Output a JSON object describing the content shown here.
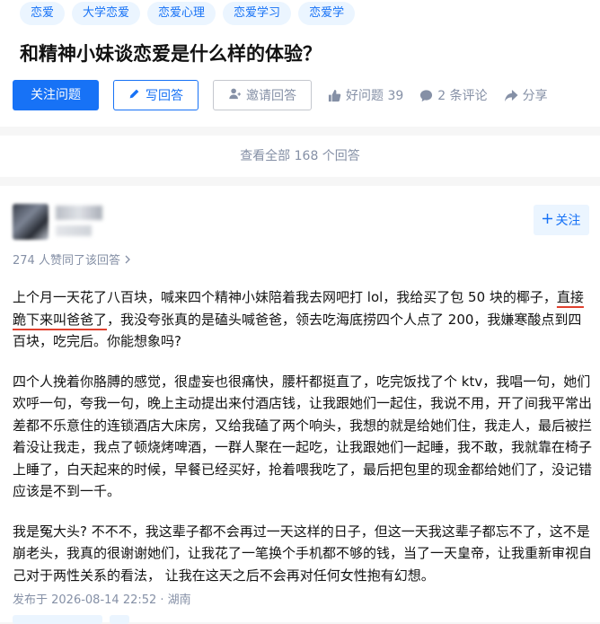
{
  "topics": [
    "恋爱",
    "大学恋爱",
    "恋爱心理",
    "恋爱学习",
    "恋爱学"
  ],
  "question": {
    "title": "和精神小妹谈恋爱是什么样的体验？"
  },
  "actions": {
    "follow_question": "关注问题",
    "write_answer": "写回答",
    "invite_answer": "邀请回答",
    "good_question": "好问题 39",
    "comments": "2 条评论",
    "share": "分享"
  },
  "view_all": "查看全部 168 个回答",
  "answer": {
    "follow_label": "关注",
    "voters": "274 人赞同了该回答",
    "p1_a": "上个月一天花了八百块，喊来四个精神小妹陪着我去网吧打 lol，我给买了包 50 块的椰子，",
    "p1_underlined": "直接跪下来叫爸爸了",
    "p1_b": "，我没夸张真的是磕头喊爸爸，领去吃海底捞四个人点了 200，我嫌寒酸点到四百块，吃完后。你能想象吗?",
    "p2": "四个人挽着你胳膊的感觉，很虚妄也很痛快，腰杆都挺直了，吃完饭找了个 ktv，我唱一句，她们欢呼一句，夸我一句，晚上主动提出来付酒店钱，让我跟她们一起住，我说不用，开了间我平常出差都不乐意住的连锁酒店大床房，又给我磕了两个响头，我想的就是给她们住，我走人，最后被拦着没让我走，我点了顿烧烤啤酒，一群人聚在一起吃，让我跟她们一起睡，我不敢，我就靠在椅子上睡了，白天起来的时候，早餐已经买好，抢着喂我吃了，最后把包里的现金都给她们了，没记错应该是不到一千。",
    "p3": "我是冤大头? 不不不，我这辈子都不会再过一天这样的日子，但这一天我这辈子都忘不了，这不是崩老头，我真的很谢谢她们，让我花了一笔换个手机都不够的钱，当了一天皇帝，让我重新审视自己对于两性关系的看法，  让我在这天之后不会再对任何女性抱有幻想。",
    "published": "发布于 2026-08-14 22:52 · 湖南"
  },
  "colors": {
    "brand_blue": "#1772f6",
    "topic_bg": "#ebf5ff",
    "muted_text": "#8590a6",
    "underline_red": "#e0402e"
  },
  "icons": [
    "pen-icon",
    "person-icon",
    "thumbs-up-icon",
    "comment-icon",
    "share-icon",
    "plus-icon",
    "chevron-right-icon"
  ]
}
